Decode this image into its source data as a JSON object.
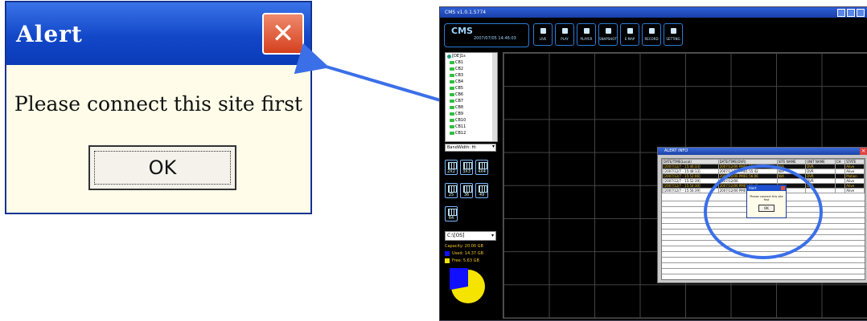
{
  "alert": {
    "title": "Alert",
    "close_glyph": "✕",
    "message": "Please connect this site first",
    "ok_label": "OK"
  },
  "cms": {
    "window_title": "CMS v1.0.1.5774",
    "logo": "CMS",
    "datetime": "2007/07/05 14:46:03",
    "toolbar": [
      "LIVE",
      "PLAY",
      "PLAYER",
      "SNAPSHOT",
      "E-MAP",
      "RECORD",
      "SETTING"
    ],
    "tree_root": "[DE]1s",
    "tree_items": [
      "CB1",
      "CB2",
      "CB3",
      "CB4",
      "CB5",
      "CB6",
      "CB7",
      "CB8",
      "CB9",
      "CB10",
      "CB11",
      "CB12"
    ],
    "bandwidth": "BandWidth: Hi",
    "layouts_row1": [
      "2X2",
      "3X3",
      "4X4"
    ],
    "layouts_row2": [
      "25",
      "36",
      "49"
    ],
    "layouts_row3": [
      "64"
    ],
    "drive": "C:\\[OS]",
    "capacity": "Capacity: 20.00 GB",
    "used": "Used: 14.37 GB",
    "free": "Free: 5.63 GB",
    "used_fraction": 0.72,
    "colors": {
      "used": "#1010ff",
      "free": "#f5e400",
      "accent": "#3b6fe8"
    }
  },
  "alert_info": {
    "title": "ALERT INFO",
    "headers": [
      "DATE/TIME(Local)",
      "DATE/TIME(DVR)",
      "SITE NAME",
      "UNIT NAME",
      "CH",
      "STATE"
    ],
    "rows": [
      [
        "[2007/12/7 - 15:46:33]",
        "2007/12/06 PM01:53:42",
        "N/A",
        "DVR",
        "",
        "Alive",
        "hl"
      ],
      [
        "[2007/12/7 - 15:48:13]",
        "2007/12/06 PM01:55:42",
        "N/A",
        "DVR",
        "",
        "Alive",
        "nm"
      ],
      [
        "[2007/12/7 - 15:52:06]",
        "2007/12/06 PM01:56:06",
        "N/A",
        "DVR",
        "",
        "Motion",
        "hl"
      ],
      [
        "[2007/12/7 - 15:52:39]",
        "2007/12/06",
        "",
        "DVR",
        "",
        "Alive",
        "nm"
      ],
      [
        "[2007/12/7 - 15:54:30]",
        "2007/12/06 PM01:53:42",
        "N/A",
        "DVR",
        "",
        "Alive",
        "hl"
      ],
      [
        "[2007/12/7 - 15:56:39]",
        "2007/12/06 PM01:55:42",
        "N/A",
        "",
        "",
        "Alive",
        "nm"
      ]
    ],
    "mini_alert": {
      "title": "Alert",
      "message": "Please connect this site first",
      "ok_label": "OK"
    }
  }
}
